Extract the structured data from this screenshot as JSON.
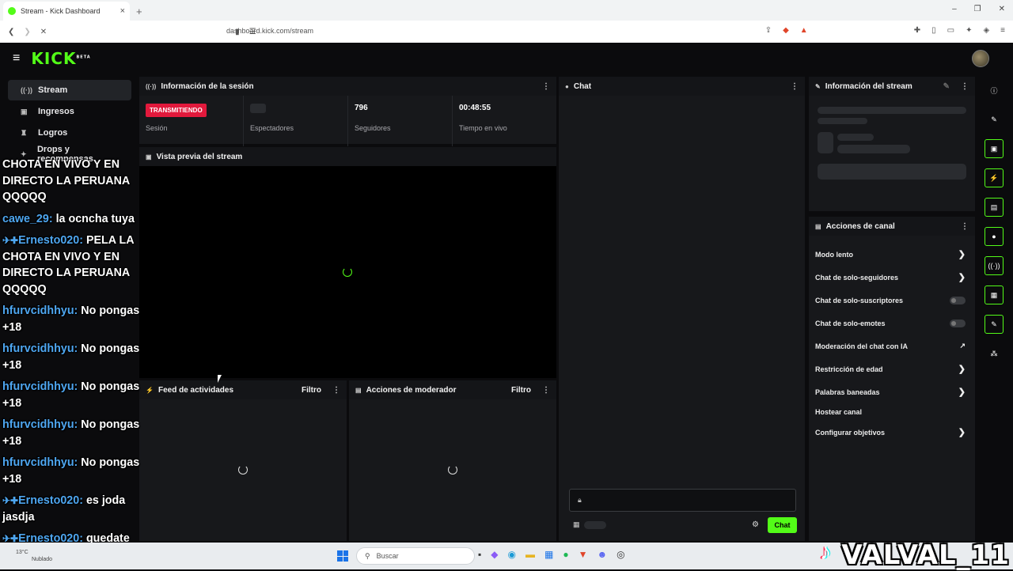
{
  "browser": {
    "tab_title": "Stream - Kick Dashboard",
    "tab_close": "×",
    "new_tab": "+",
    "url": "dashboard.kick.com/stream",
    "win_min": "–",
    "win_max": "❐",
    "win_close": "✕"
  },
  "app": {
    "logo": "KICK",
    "logo_sup": "BETA",
    "accent": "#53fc18"
  },
  "sidebar": {
    "items": [
      {
        "label": "Stream",
        "icon": "broadcast-icon"
      },
      {
        "label": "Ingresos",
        "icon": "money-icon"
      },
      {
        "label": "Logros",
        "icon": "trophy-icon"
      },
      {
        "label": "Drops y recompensas",
        "icon": "gift-icon"
      }
    ]
  },
  "session": {
    "title": "Información de la sesión",
    "badge": "TRANSMITIENDO",
    "stats": [
      {
        "label": "Sesión",
        "value": ""
      },
      {
        "label": "Espectadores",
        "value": ""
      },
      {
        "label": "Seguidores",
        "value": "796"
      },
      {
        "label": "Tiempo en vivo",
        "value": "00:48:55"
      }
    ]
  },
  "preview": {
    "title": "Vista previa del stream"
  },
  "activity": {
    "title": "Feed de actividades",
    "filter": "Filtro"
  },
  "moderator": {
    "title": "Acciones de moderador",
    "filter": "Filtro"
  },
  "chat": {
    "title": "Chat",
    "send_label": "Chat"
  },
  "stream_info": {
    "title": "Información del stream"
  },
  "channel_actions": {
    "title": "Acciones de canal",
    "items": [
      {
        "label": "Modo lento",
        "control": "arrow"
      },
      {
        "label": "Chat de solo-seguidores",
        "control": "arrow"
      },
      {
        "label": "Chat de solo-suscriptores",
        "control": "toggle"
      },
      {
        "label": "Chat de solo-emotes",
        "control": "toggle"
      },
      {
        "label": "Moderación del chat con IA",
        "control": "external"
      },
      {
        "label": "Restricción de edad",
        "control": "arrow"
      },
      {
        "label": "Palabras baneadas",
        "control": "arrow"
      },
      {
        "label": "Hostear canal",
        "control": "none"
      },
      {
        "label": "Configurar objetivos",
        "control": "arrow"
      }
    ]
  },
  "overlay_chat": [
    {
      "name": "",
      "text": "CHOTA EN VIVO Y EN DIRECTO LA PERUANA QQQQQ"
    },
    {
      "name": "cawe_29:",
      "text": "la ocncha tuya"
    },
    {
      "name": "Ernesto020:",
      "text": "PELA LA CHOTA EN VIVO Y EN DIRECTO LA PERUANA QQQQQ"
    },
    {
      "name": "hfurvcidhhyu:",
      "text": "No pongas +18"
    },
    {
      "name": "hfurvcidhhyu:",
      "text": "No pongas +18"
    },
    {
      "name": "hfurvcidhhyu:",
      "text": "No pongas +18"
    },
    {
      "name": "hfurvcidhhyu:",
      "text": "No pongas +18"
    },
    {
      "name": "hfurvcidhhyu:",
      "text": "No pongas +18"
    },
    {
      "name": "Ernesto020:",
      "text": "es joda jasdja"
    },
    {
      "name": "Ernesto020:",
      "text": "quedate tranquilo"
    }
  ],
  "taskbar": {
    "search_placeholder": "Buscar",
    "weather_temp": "13°C",
    "weather_desc": "Nublado"
  },
  "watermark": "VALVAL_11"
}
